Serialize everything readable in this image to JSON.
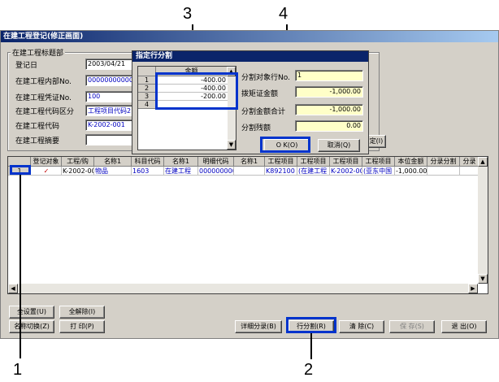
{
  "callouts": {
    "c1": "1",
    "c2": "2",
    "c3": "3",
    "c4": "4"
  },
  "window": {
    "title": "在建工程登记(修正画面)"
  },
  "header_group": {
    "title": "在建工程标题部",
    "fields": [
      {
        "label": "登记日",
        "value": "2003/04/21"
      },
      {
        "label": "在建工程内部No.",
        "value": "000000000007"
      },
      {
        "label": "在建工程凭证No.",
        "value": "100"
      },
      {
        "label": "在建工程代码区分",
        "value": "工程项目代码2"
      },
      {
        "label": "在建工程代码",
        "value": "K-2002-001"
      },
      {
        "label": "在建工程摘要",
        "value": ""
      }
    ]
  },
  "hidden_btn_label": "定(I)",
  "dialog": {
    "title": "指定行分割",
    "table_header": "金额",
    "rows": [
      {
        "num": "1",
        "amount": "-400.00"
      },
      {
        "num": "2",
        "amount": "-400.00"
      },
      {
        "num": "3",
        "amount": "-200.00"
      },
      {
        "num": "4",
        "amount": ""
      }
    ],
    "fields": [
      {
        "label": "分割对象行No.",
        "value": "1"
      },
      {
        "label": "拨矩证金额",
        "value": "-1,000.00"
      },
      {
        "label": "分割金额合计",
        "value": "-1,000.00"
      },
      {
        "label": "分割残额",
        "value": "0.00"
      }
    ],
    "ok_label": "O K(O)",
    "cancel_label": "取消(Q)"
  },
  "grid": {
    "headers": [
      "",
      "登记对象",
      "工程/购",
      "名称1",
      "科目代码",
      "名称1",
      "明细代码",
      "名称1",
      "工程项目",
      "工程项目",
      "工程项目",
      "工程项目",
      "本位金额",
      "分录分割",
      "分录"
    ],
    "row": [
      "1",
      "✓",
      "K-2002-00",
      "物品",
      "1603",
      "在建工程",
      "000000000",
      "",
      "K892100",
      "(在建工程",
      "K-2002-00",
      "(亚东中国",
      "-1,000.00",
      "",
      ""
    ]
  },
  "buttons": {
    "select_all": "全设置(U)",
    "deselect_all": "全解除(I)",
    "name_toggle": "名称切换(Z)",
    "print": "打 印(P)",
    "detail": "详细分录(B)",
    "split": "行分割(R)",
    "clear": "清 除(C)",
    "save": "保 存(S)",
    "exit": "退 出(O)"
  }
}
